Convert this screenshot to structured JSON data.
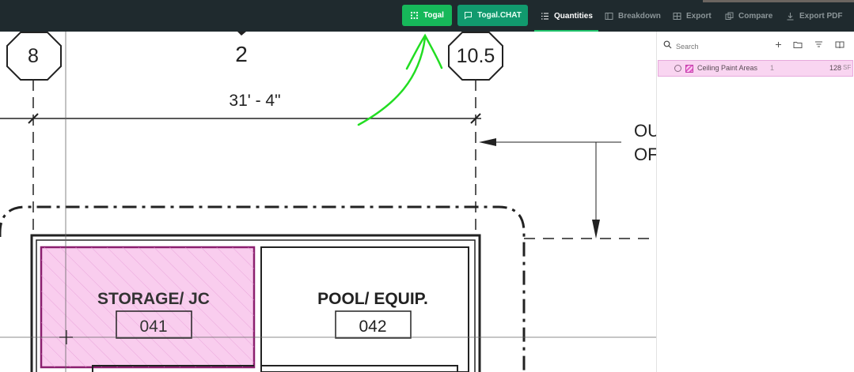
{
  "toolbar": {
    "togal_label": "Togal",
    "togal_chat_label": "Togal.CHAT",
    "nav": [
      {
        "label": "Quantities",
        "icon": "list-icon",
        "active": true
      },
      {
        "label": "Breakdown",
        "icon": "breakdown-icon",
        "active": false
      },
      {
        "label": "Export",
        "icon": "table-icon",
        "active": false
      },
      {
        "label": "Compare",
        "icon": "compare-icon",
        "active": false
      },
      {
        "label": "Export PDF",
        "icon": "download-icon",
        "active": false
      }
    ],
    "accent": "#16b85a"
  },
  "drawing": {
    "grid_markers": [
      "8",
      "2",
      "10.5"
    ],
    "dimension": "31' - 4\"",
    "side_note_lines": [
      "OU",
      "OF"
    ],
    "rooms": [
      {
        "name": "STORAGE/ JC",
        "number": "041",
        "highlighted": true
      },
      {
        "name": "POOL/ EQUIP.",
        "number": "042",
        "highlighted": false
      }
    ],
    "highlight_color": "#f9cdee",
    "annotation_color": "#22dd22"
  },
  "panel": {
    "search_placeholder": "Search",
    "icons": [
      "plus-icon",
      "folder-icon",
      "filter-icon",
      "book-icon"
    ],
    "items": [
      {
        "name": "Ceiling Paint Areas",
        "count": "1",
        "quantity": "128",
        "unit": "SF"
      }
    ]
  }
}
